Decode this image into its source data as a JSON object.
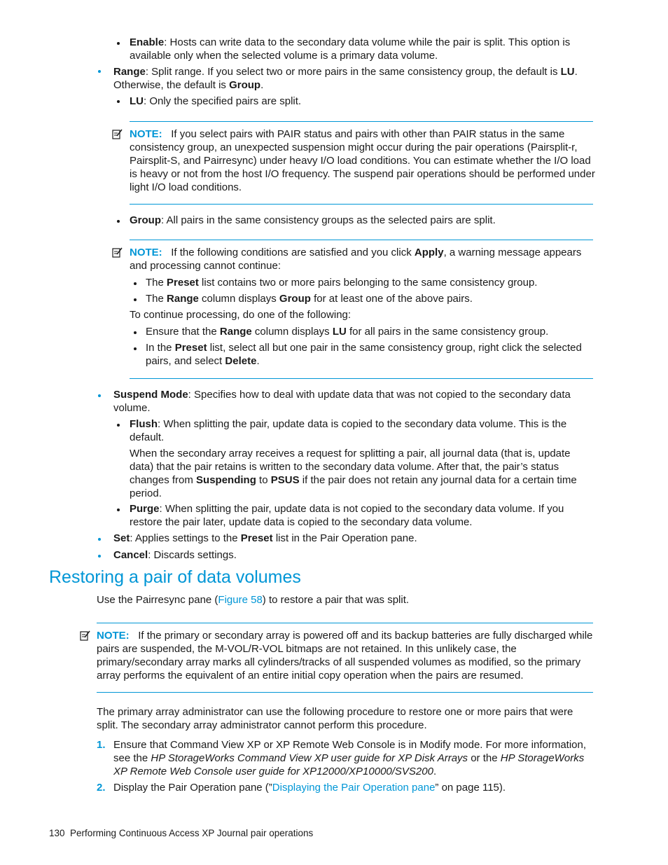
{
  "top_list": {
    "enable": {
      "term": "Enable",
      "text": ": Hosts can write data to the secondary data volume while the pair is split. This option is available only when the selected volume is a primary data volume."
    },
    "range": {
      "term": "Range",
      "text1": ": Split range. If you select two or more pairs in the same consistency group, the default is ",
      "lu": "LU",
      "text2": ". Otherwise, the default is ",
      "group": "Group",
      "text3": "."
    },
    "lu": {
      "term": "LU",
      "text": ": Only the specified pairs are split."
    }
  },
  "note1": {
    "label": "NOTE:",
    "text": "If you select pairs with PAIR status and pairs with other than PAIR status in the same consistency group, an unexpected suspension might occur during the pair operations (Pairsplit-r, Pairsplit-S, and Pairresync) under heavy I/O load conditions. You can estimate whether the I/O load is heavy or not from the host I/O frequency. The suspend pair operations should be performed under light I/O load conditions."
  },
  "group_item": {
    "term": "Group",
    "text": ": All pairs in the same consistency groups as the selected pairs are split."
  },
  "note2": {
    "label": "NOTE:",
    "intro1": "If the following conditions are satisfied and you click ",
    "apply": "Apply",
    "intro2": ", a warning message appears and processing cannot continue:",
    "cond1": {
      "pre": "The ",
      "b1": "Preset",
      "post": " list contains two or more pairs belonging to the same consistency group."
    },
    "cond2": {
      "pre": "The ",
      "b1": "Range",
      "mid": " column displays ",
      "b2": "Group",
      "post": " for at least one of the above pairs."
    },
    "continue": "To continue processing, do one of the following:",
    "opt1": {
      "pre": "Ensure that the ",
      "b1": "Range",
      "mid": " column displays ",
      "b2": "LU",
      "post": " for all pairs in the same consistency group."
    },
    "opt2": {
      "pre": "In the ",
      "b1": "Preset",
      "mid": " list, select all but one pair in the same consistency group, right click the selected pairs, and select ",
      "b2": "Delete",
      "post": "."
    }
  },
  "suspend": {
    "term": "Suspend Mode",
    "text": ": Specifies how to deal with update data that was not copied to the secondary data volume.",
    "flush": {
      "term": "Flush",
      "text": ": When splitting the pair, update data is copied to the secondary data volume. This is the default."
    },
    "flush_para": {
      "pre": "When the secondary array receives a request for splitting a pair, all journal data (that is, update data) that the pair retains is written to the secondary data volume. After that, the pair’s status changes from ",
      "b1": "Suspending",
      "mid": " to ",
      "b2": "PSUS",
      "post": " if the pair does not retain any journal data for a certain time period."
    },
    "purge": {
      "term": "Purge",
      "text": ": When splitting the pair, update data is not copied to the secondary data volume. If you restore the pair later, update data is copied to the secondary data volume."
    }
  },
  "set_item": {
    "term": "Set",
    "pre": ": Applies settings to the ",
    "b1": "Preset",
    "post": " list in the Pair Operation pane."
  },
  "cancel_item": {
    "term": "Cancel",
    "text": ": Discards settings."
  },
  "section": {
    "title": "Restoring a pair of data volumes",
    "intro_pre": "Use the Pairresync pane (",
    "intro_link": "Figure 58",
    "intro_post": ") to restore a pair that was split."
  },
  "note3": {
    "label": "NOTE:",
    "text": "If the primary or secondary array is powered off and its backup batteries are fully discharged while pairs are suspended, the M-VOL/R-VOL bitmaps are not retained. In this unlikely case, the primary/secondary array marks all cylinders/tracks of all suspended volumes as modified, so the primary array performs the equivalent of an entire initial copy operation when the pairs are resumed."
  },
  "procedure_intro": "The primary array administrator can use the following procedure to restore one or more pairs that were split. The secondary array administrator cannot perform this procedure.",
  "steps": [
    {
      "num": "1.",
      "pre": "Ensure that Command View XP or XP Remote Web Console is in Modify mode. For more information, see the ",
      "i1": "HP StorageWorks Command View XP user guide for XP Disk Arrays",
      "mid": " or the ",
      "i2": "HP StorageWorks XP Remote Web Console user guide for XP12000/XP10000/SVS200",
      "post": "."
    },
    {
      "num": "2.",
      "pre": "Display the Pair Operation pane (”",
      "link": "Displaying the Pair Operation pane",
      "post": "” on page 115)."
    }
  ],
  "footer": {
    "page": "130",
    "title": "Performing Continuous Access XP Journal pair operations"
  }
}
